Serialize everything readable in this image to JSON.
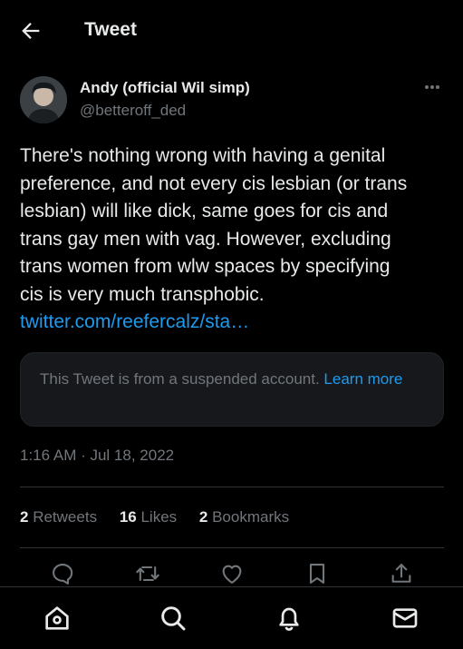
{
  "header": {
    "title": "Tweet"
  },
  "tweet": {
    "author_name": "Andy (official Wil simp)",
    "author_handle": "@betteroff_ded",
    "text_lines": [
      "There's nothing wrong with having a genital",
      "preference, and not every cis lesbian (or trans",
      "lesbian) will like dick, same goes for cis and",
      "trans gay men with vag. However, excluding",
      "trans women from wlw spaces by specifying",
      "cis is very much transphobic."
    ],
    "link": "twitter.com/reefercalz/sta…",
    "quote": {
      "text": "This Tweet is from a suspended account.",
      "link_label": "Learn more"
    },
    "timestamp": "1:16 AM · Jul 18, 2022",
    "stats": {
      "retweets_count": "2",
      "retweets_label": "Retweets",
      "likes_count": "16",
      "likes_label": "Likes",
      "bookmarks_count": "2",
      "bookmarks_label": "Bookmarks"
    }
  },
  "actions": [
    "reply-icon",
    "retweet-icon",
    "like-icon",
    "bookmark-icon",
    "share-icon"
  ],
  "bottom_nav": [
    "home-icon",
    "search-icon",
    "notifications-icon",
    "messages-icon"
  ],
  "colors": {
    "background": "#000000",
    "text": "#e7e9ea",
    "muted": "#71767b",
    "accent": "#1d9bf0",
    "border": "#2f3336"
  }
}
